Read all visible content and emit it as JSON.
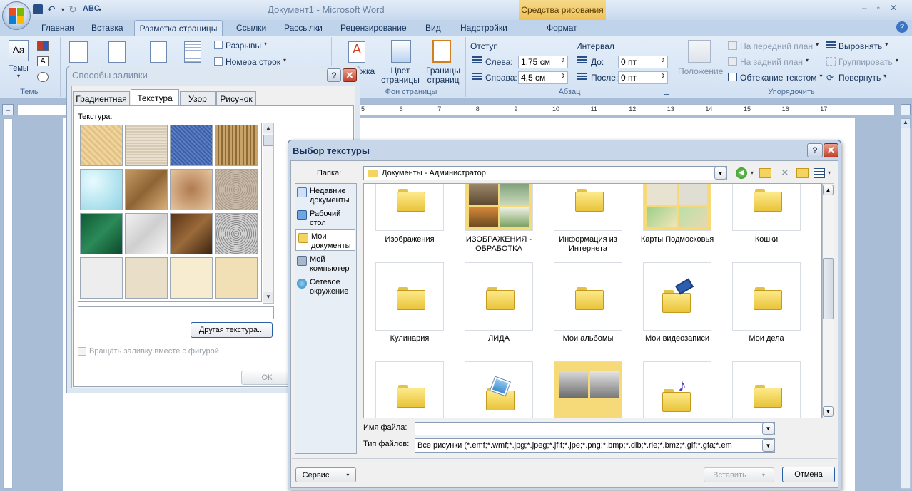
{
  "titlebar": {
    "title": "Документ1 - Microsoft Word",
    "contextual_tab": "Средства рисования"
  },
  "ribbon_tabs": [
    {
      "label": "Главная"
    },
    {
      "label": "Вставка"
    },
    {
      "label": "Разметка страницы"
    },
    {
      "label": "Ссылки"
    },
    {
      "label": "Рассылки"
    },
    {
      "label": "Рецензирование"
    },
    {
      "label": "Вид"
    },
    {
      "label": "Надстройки"
    },
    {
      "label": "Формат"
    }
  ],
  "ribbon": {
    "themes_button": "Темы",
    "themes_group": "Темы",
    "breaks": "Разрывы",
    "line_numbers": "Номера строк",
    "watermark_partial": "жка",
    "page_color_l1": "Цвет",
    "page_color_l2": "страницы",
    "page_borders_l1": "Границы",
    "page_borders_l2": "страниц",
    "page_bg_group": "Фон страницы",
    "indent_header": "Отступ",
    "indent_left_label": "Слева:",
    "indent_left_value": "1,75 см",
    "indent_right_label": "Справа:",
    "indent_right_value": "4,5 см",
    "spacing_header": "Интервал",
    "spacing_before_label": "До:",
    "spacing_before_value": "0 пт",
    "spacing_after_label": "После:",
    "spacing_after_value": "0 пт",
    "paragraph_group": "Абзац",
    "position": "Положение",
    "bring_front": "На передний план",
    "send_back": "На задний план",
    "text_wrap": "Обтекание текстом",
    "align": "Выровнять",
    "group": "Группировать",
    "rotate": "Повернуть",
    "arrange_group": "Упорядочить"
  },
  "ruler": [
    "5",
    "6",
    "7",
    "8",
    "9",
    "10",
    "11",
    "12",
    "13",
    "14",
    "15",
    "16",
    "17"
  ],
  "fill_dialog": {
    "title": "Способы заливки",
    "tabs": [
      {
        "label": "Градиентная"
      },
      {
        "label": "Текстура"
      },
      {
        "label": "Узор"
      },
      {
        "label": "Рисунок"
      }
    ],
    "texture_label": "Текстура:",
    "name_value": "",
    "other_texture": "Другая текстура...",
    "rotate_checkbox": "Вращать заливку вместе с фигурой",
    "ok": "ОК"
  },
  "texture_dialog": {
    "title": "Выбор текстуры",
    "folder_label": "Папка:",
    "folder_value": "Документы - Администратор",
    "places": [
      {
        "label": "Недавние документы"
      },
      {
        "label": "Рабочий стол"
      },
      {
        "label": "Мои документы"
      },
      {
        "label": "Мой компьютер"
      },
      {
        "label": "Сетевое окружение"
      }
    ],
    "folders": [
      {
        "name": "Изображения"
      },
      {
        "name": "ИЗОБРАЖЕНИЯ - ОБРАБОТКА"
      },
      {
        "name": "Информация из Интернета"
      },
      {
        "name": "Карты Подмосковья"
      },
      {
        "name": "Кошки"
      },
      {
        "name": "Кулинария"
      },
      {
        "name": "ЛИДА"
      },
      {
        "name": "Мои альбомы"
      },
      {
        "name": "Мои видеозаписи"
      },
      {
        "name": "Мои дела"
      }
    ],
    "filename_label": "Имя файла:",
    "filename_value": "",
    "filetype_label": "Тип файлов:",
    "filetype_value": "Все рисунки (*.emf;*.wmf;*.jpg;*.jpeg;*.jfif;*.jpe;*.png;*.bmp;*.dib;*.rle;*.bmz;*.gif;*.gfa;*.em",
    "service": "Сервис",
    "insert": "Вставить",
    "cancel": "Отмена"
  },
  "colors": {
    "accent": "#1e395b",
    "ribbon_bg": "#dbe7f5",
    "dialog_bg": "#f0f0f0"
  }
}
